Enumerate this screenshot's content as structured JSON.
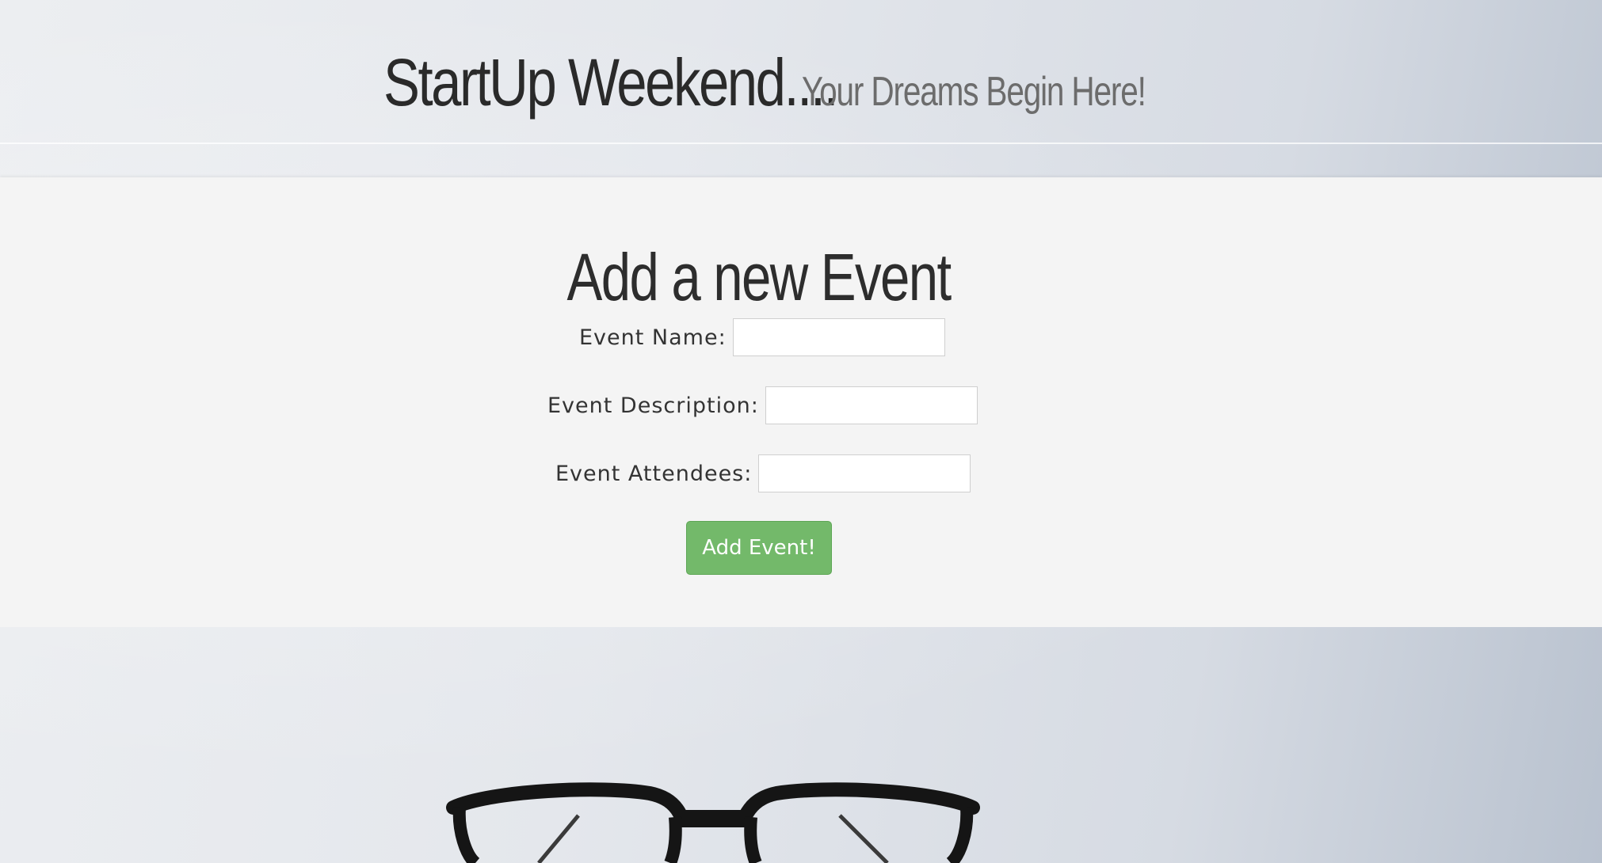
{
  "header": {
    "title": "StartUp Weekend....",
    "tagline": "Your Dreams Begin Here!"
  },
  "form": {
    "title": "Add a new Event",
    "fields": [
      {
        "label": "Event Name:",
        "value": "",
        "placeholder": ""
      },
      {
        "label": "Event Description:",
        "value": "",
        "placeholder": ""
      },
      {
        "label": "Event Attendees:",
        "value": "",
        "placeholder": ""
      }
    ],
    "submit_label": "Add Event!"
  },
  "colors": {
    "submit_button": "#73b96a",
    "panel_background": "#f4f4f4",
    "title_text": "#2a2a2a",
    "tagline_text": "#6c6c6c"
  },
  "background": {
    "image_subject": "eyeglasses-icon"
  }
}
